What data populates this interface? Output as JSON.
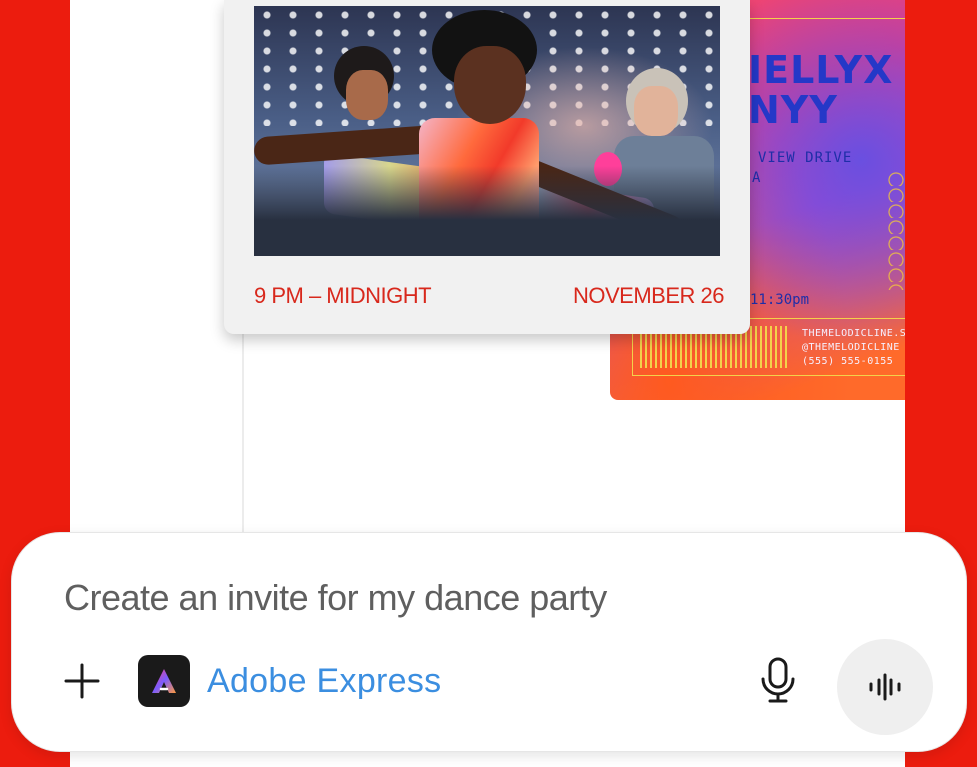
{
  "flyer_back": {
    "title_line1": "IELLYX",
    "title_line2": "NYY",
    "address": "VIEW DRIVE",
    "address2": "A",
    "time": "11:30pm",
    "contact1": "THEMELODICLINE.S",
    "contact2": "@THEMELODICLINE",
    "contact3": "(555) 555-0155"
  },
  "invite_card": {
    "time": "9 PM – MIDNIGHT",
    "date": "NOVEMBER 26",
    "accent_color": "#d8281c"
  },
  "composer": {
    "prompt_text": "Create an invite for my dance party",
    "app_name": "Adobe Express",
    "app_color": "#3b8ee0",
    "icons": {
      "add": "plus-icon",
      "app": "adobe-express-icon",
      "mic": "microphone-icon",
      "voice": "voice-waveform-icon"
    }
  },
  "colors": {
    "background": "#ec1c0e",
    "screen": "#ffffff"
  }
}
